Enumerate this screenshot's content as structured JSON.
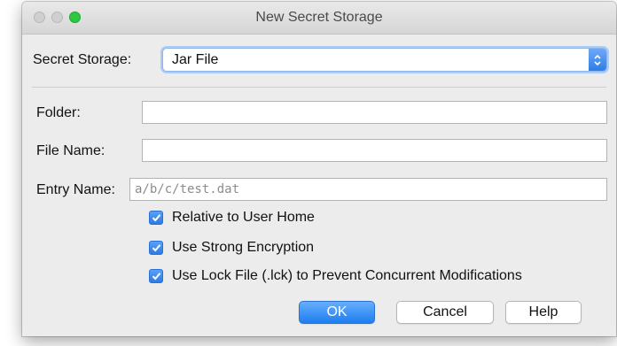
{
  "window": {
    "title": "New Secret Storage"
  },
  "form": {
    "storage_label": "Secret Storage:",
    "storage_value": "Jar File",
    "folder_label": "Folder:",
    "folder_value": "",
    "file_name_label": "File Name:",
    "file_name_value": "",
    "entry_name_label": "Entry Name:",
    "entry_name_placeholder": "a/b/c/test.dat"
  },
  "options": [
    {
      "label": "Relative to User Home",
      "checked": true
    },
    {
      "label": "Use Strong Encryption",
      "checked": true
    },
    {
      "label": "Use Lock File (.lck) to Prevent Concurrent Modifications",
      "checked": true
    }
  ],
  "buttons": {
    "ok": "OK",
    "cancel": "Cancel",
    "help": "Help"
  },
  "colors": {
    "accent": "#2f7de6",
    "window_bg": "#ececec"
  }
}
